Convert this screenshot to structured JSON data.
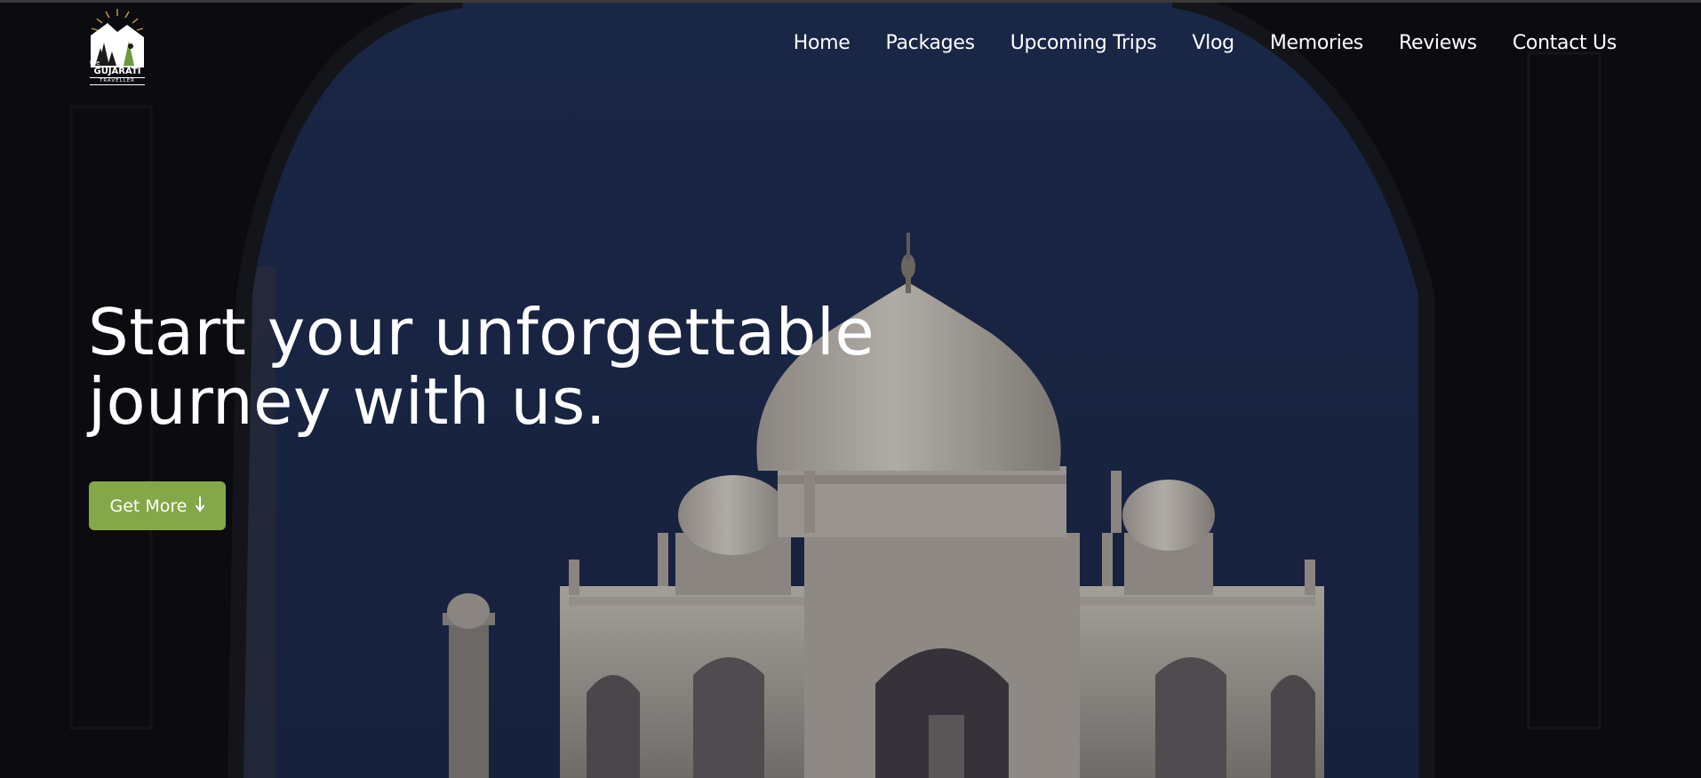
{
  "brand": {
    "logo_text_top": "the",
    "logo_text_main": "GUJARATI",
    "logo_text_sub": "TRAVELLER"
  },
  "nav": {
    "items": [
      {
        "label": "Home"
      },
      {
        "label": "Packages"
      },
      {
        "label": "Upcoming Trips"
      },
      {
        "label": "Vlog"
      },
      {
        "label": "Memories"
      },
      {
        "label": "Reviews"
      },
      {
        "label": "Contact Us"
      }
    ]
  },
  "hero": {
    "headline_line1": "Start your unforgettable",
    "headline_line2": "journey with us.",
    "cta_label": "Get More",
    "cta_icon": "arrow-down-icon"
  },
  "colors": {
    "accent": "#84a74a",
    "sky": "#16213d",
    "text": "#ffffff"
  }
}
